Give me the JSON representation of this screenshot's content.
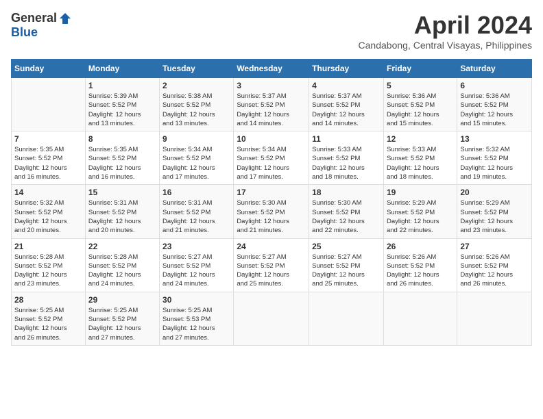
{
  "header": {
    "logo_general": "General",
    "logo_blue": "Blue",
    "month_title": "April 2024",
    "location": "Candabong, Central Visayas, Philippines"
  },
  "calendar": {
    "days_of_week": [
      "Sunday",
      "Monday",
      "Tuesday",
      "Wednesday",
      "Thursday",
      "Friday",
      "Saturday"
    ],
    "weeks": [
      [
        {
          "day": "",
          "info": ""
        },
        {
          "day": "1",
          "info": "Sunrise: 5:39 AM\nSunset: 5:52 PM\nDaylight: 12 hours\nand 13 minutes."
        },
        {
          "day": "2",
          "info": "Sunrise: 5:38 AM\nSunset: 5:52 PM\nDaylight: 12 hours\nand 13 minutes."
        },
        {
          "day": "3",
          "info": "Sunrise: 5:37 AM\nSunset: 5:52 PM\nDaylight: 12 hours\nand 14 minutes."
        },
        {
          "day": "4",
          "info": "Sunrise: 5:37 AM\nSunset: 5:52 PM\nDaylight: 12 hours\nand 14 minutes."
        },
        {
          "day": "5",
          "info": "Sunrise: 5:36 AM\nSunset: 5:52 PM\nDaylight: 12 hours\nand 15 minutes."
        },
        {
          "day": "6",
          "info": "Sunrise: 5:36 AM\nSunset: 5:52 PM\nDaylight: 12 hours\nand 15 minutes."
        }
      ],
      [
        {
          "day": "7",
          "info": "Sunrise: 5:35 AM\nSunset: 5:52 PM\nDaylight: 12 hours\nand 16 minutes."
        },
        {
          "day": "8",
          "info": "Sunrise: 5:35 AM\nSunset: 5:52 PM\nDaylight: 12 hours\nand 16 minutes."
        },
        {
          "day": "9",
          "info": "Sunrise: 5:34 AM\nSunset: 5:52 PM\nDaylight: 12 hours\nand 17 minutes."
        },
        {
          "day": "10",
          "info": "Sunrise: 5:34 AM\nSunset: 5:52 PM\nDaylight: 12 hours\nand 17 minutes."
        },
        {
          "day": "11",
          "info": "Sunrise: 5:33 AM\nSunset: 5:52 PM\nDaylight: 12 hours\nand 18 minutes."
        },
        {
          "day": "12",
          "info": "Sunrise: 5:33 AM\nSunset: 5:52 PM\nDaylight: 12 hours\nand 18 minutes."
        },
        {
          "day": "13",
          "info": "Sunrise: 5:32 AM\nSunset: 5:52 PM\nDaylight: 12 hours\nand 19 minutes."
        }
      ],
      [
        {
          "day": "14",
          "info": "Sunrise: 5:32 AM\nSunset: 5:52 PM\nDaylight: 12 hours\nand 20 minutes."
        },
        {
          "day": "15",
          "info": "Sunrise: 5:31 AM\nSunset: 5:52 PM\nDaylight: 12 hours\nand 20 minutes."
        },
        {
          "day": "16",
          "info": "Sunrise: 5:31 AM\nSunset: 5:52 PM\nDaylight: 12 hours\nand 21 minutes."
        },
        {
          "day": "17",
          "info": "Sunrise: 5:30 AM\nSunset: 5:52 PM\nDaylight: 12 hours\nand 21 minutes."
        },
        {
          "day": "18",
          "info": "Sunrise: 5:30 AM\nSunset: 5:52 PM\nDaylight: 12 hours\nand 22 minutes."
        },
        {
          "day": "19",
          "info": "Sunrise: 5:29 AM\nSunset: 5:52 PM\nDaylight: 12 hours\nand 22 minutes."
        },
        {
          "day": "20",
          "info": "Sunrise: 5:29 AM\nSunset: 5:52 PM\nDaylight: 12 hours\nand 23 minutes."
        }
      ],
      [
        {
          "day": "21",
          "info": "Sunrise: 5:28 AM\nSunset: 5:52 PM\nDaylight: 12 hours\nand 23 minutes."
        },
        {
          "day": "22",
          "info": "Sunrise: 5:28 AM\nSunset: 5:52 PM\nDaylight: 12 hours\nand 24 minutes."
        },
        {
          "day": "23",
          "info": "Sunrise: 5:27 AM\nSunset: 5:52 PM\nDaylight: 12 hours\nand 24 minutes."
        },
        {
          "day": "24",
          "info": "Sunrise: 5:27 AM\nSunset: 5:52 PM\nDaylight: 12 hours\nand 25 minutes."
        },
        {
          "day": "25",
          "info": "Sunrise: 5:27 AM\nSunset: 5:52 PM\nDaylight: 12 hours\nand 25 minutes."
        },
        {
          "day": "26",
          "info": "Sunrise: 5:26 AM\nSunset: 5:52 PM\nDaylight: 12 hours\nand 26 minutes."
        },
        {
          "day": "27",
          "info": "Sunrise: 5:26 AM\nSunset: 5:52 PM\nDaylight: 12 hours\nand 26 minutes."
        }
      ],
      [
        {
          "day": "28",
          "info": "Sunrise: 5:25 AM\nSunset: 5:52 PM\nDaylight: 12 hours\nand 26 minutes."
        },
        {
          "day": "29",
          "info": "Sunrise: 5:25 AM\nSunset: 5:52 PM\nDaylight: 12 hours\nand 27 minutes."
        },
        {
          "day": "30",
          "info": "Sunrise: 5:25 AM\nSunset: 5:53 PM\nDaylight: 12 hours\nand 27 minutes."
        },
        {
          "day": "",
          "info": ""
        },
        {
          "day": "",
          "info": ""
        },
        {
          "day": "",
          "info": ""
        },
        {
          "day": "",
          "info": ""
        }
      ]
    ]
  }
}
